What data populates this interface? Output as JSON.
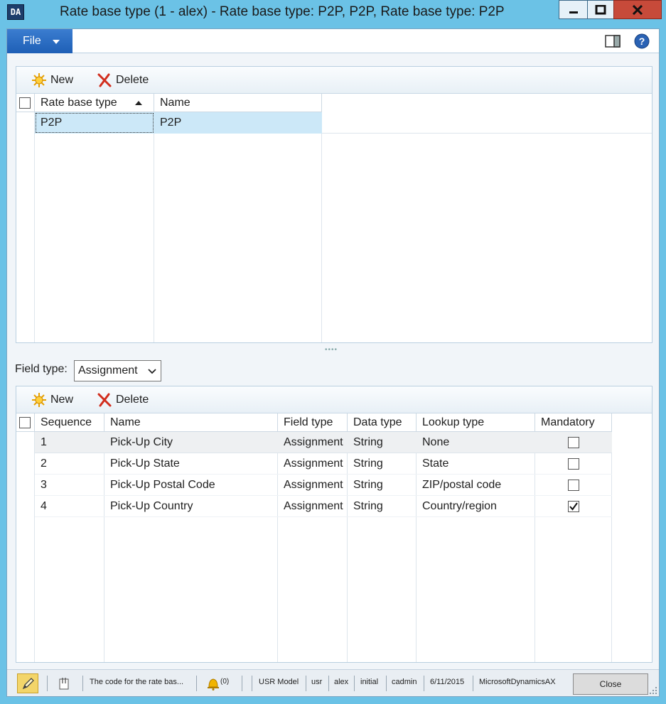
{
  "window": {
    "title": "Rate base type (1 - alex) - Rate base type: P2P, P2P, Rate base type: P2P",
    "app_icon_text": "DA"
  },
  "menubar": {
    "file_label": "File"
  },
  "top_pane": {
    "actions": {
      "new_label": "New",
      "delete_label": "Delete"
    },
    "columns": [
      "Rate base type",
      "Name"
    ],
    "rows": [
      {
        "rate_base_type": "P2P",
        "name": "P2P"
      }
    ]
  },
  "field_type": {
    "label": "Field type:",
    "value": "Assignment"
  },
  "bottom_pane": {
    "actions": {
      "new_label": "New",
      "delete_label": "Delete"
    },
    "columns": [
      "Sequence",
      "Name",
      "Field type",
      "Data type",
      "Lookup type",
      "Mandatory"
    ],
    "rows": [
      {
        "sequence": "1",
        "name": "Pick-Up City",
        "field_type": "Assignment",
        "data_type": "String",
        "lookup_type": "None",
        "mandatory": false
      },
      {
        "sequence": "2",
        "name": "Pick-Up State",
        "field_type": "Assignment",
        "data_type": "String",
        "lookup_type": "State",
        "mandatory": false
      },
      {
        "sequence": "3",
        "name": "Pick-Up Postal Code",
        "field_type": "Assignment",
        "data_type": "String",
        "lookup_type": "ZIP/postal code",
        "mandatory": false
      },
      {
        "sequence": "4",
        "name": "Pick-Up Country",
        "field_type": "Assignment",
        "data_type": "String",
        "lookup_type": "Country/region",
        "mandatory": true
      }
    ]
  },
  "statusbar": {
    "help_text": "The code for the rate bas...",
    "notifications": "(0)",
    "model": "USR Model",
    "layer": "usr",
    "user": "alex",
    "partition": "initial",
    "company": "cadmin",
    "date": "6/11/2015",
    "application": "MicrosoftDynamicsAX",
    "close_label": "Close"
  },
  "colors": {
    "accent": "#1e5fb6",
    "frame": "#6bc2e6",
    "selected_row": "#cce8f8",
    "close_button": "#c74a3a"
  }
}
